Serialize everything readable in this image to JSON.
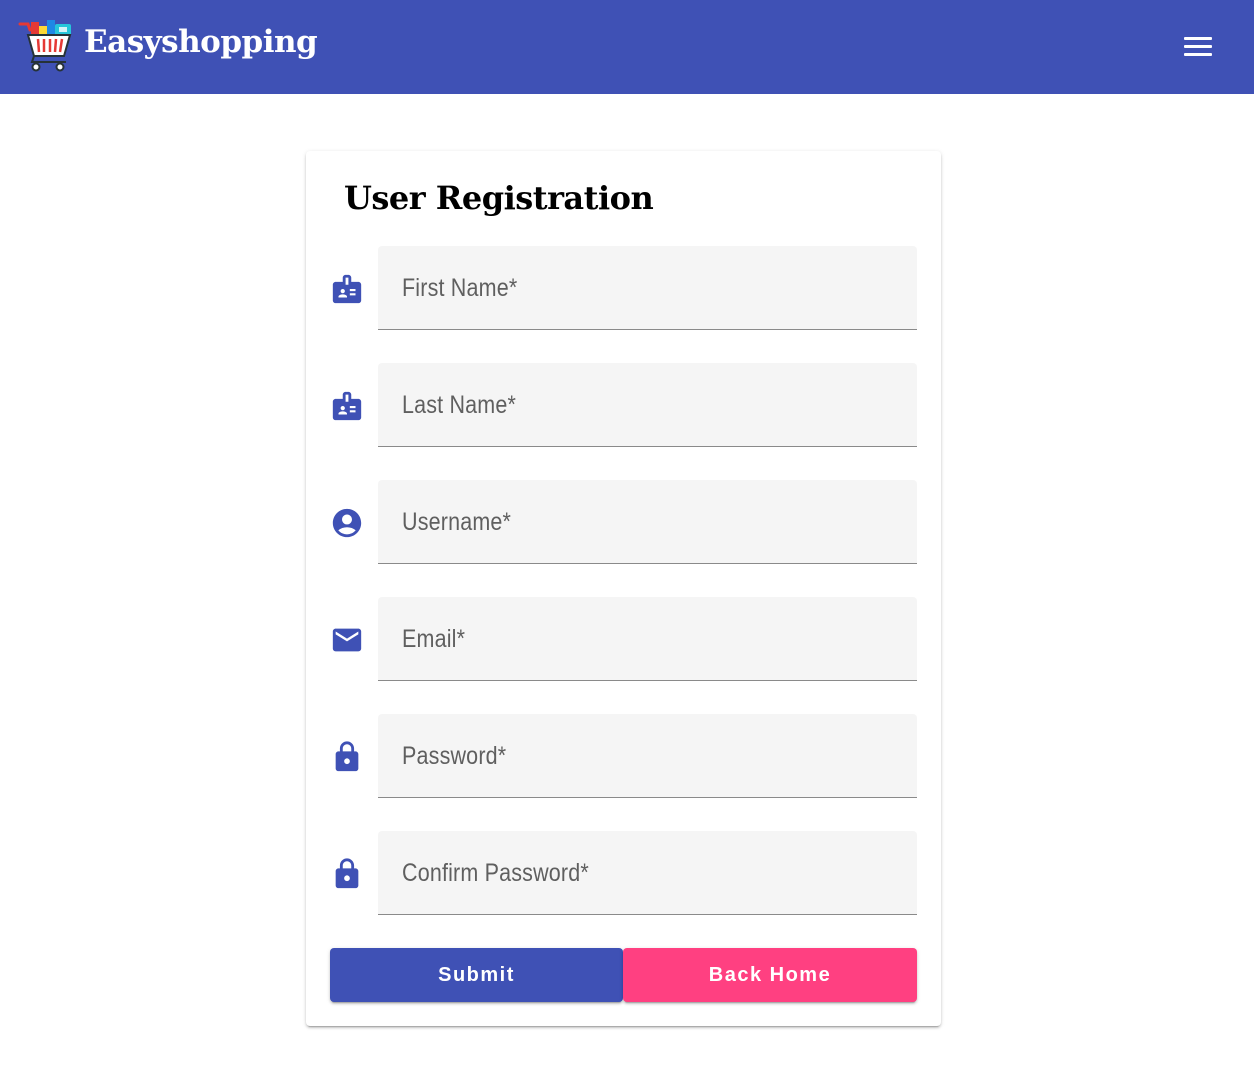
{
  "app": {
    "brand": "Easyshopping"
  },
  "header": {
    "logo_icon": "shopping-cart-icon",
    "menu_icon": "hamburger-menu-icon"
  },
  "form": {
    "title": "User Registration",
    "fields": [
      {
        "label": "First Name*",
        "icon": "badge-icon",
        "value": ""
      },
      {
        "label": "Last Name*",
        "icon": "badge-icon",
        "value": ""
      },
      {
        "label": "Username*",
        "icon": "account-circle-icon",
        "value": ""
      },
      {
        "label": "Email*",
        "icon": "email-icon",
        "value": ""
      },
      {
        "label": "Password*",
        "icon": "lock-icon",
        "value": ""
      },
      {
        "label": "Confirm Password*",
        "icon": "lock-icon",
        "value": ""
      }
    ],
    "submit_label": "Submit",
    "back_label": "Back Home"
  },
  "colors": {
    "primary": "#3f51b5",
    "accent": "#ff4081",
    "field_bg": "#f5f5f5"
  }
}
